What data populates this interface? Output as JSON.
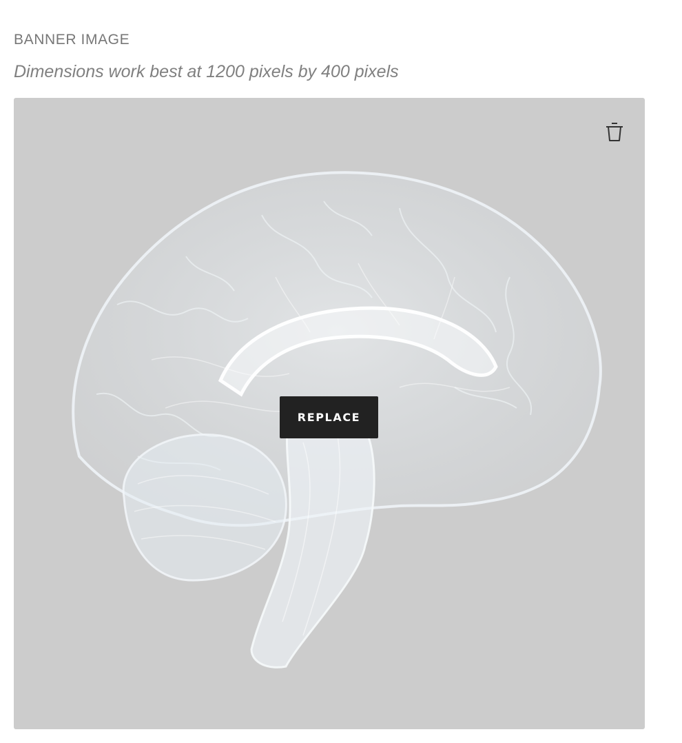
{
  "field": {
    "label": "BANNER IMAGE",
    "hint": "Dimensions work best at 1200 pixels by 400 pixels"
  },
  "image": {
    "subject": "translucent-brain-illustration",
    "background_color": "#cccccc"
  },
  "actions": {
    "replace_label": "REPLACE",
    "delete_icon": "trash-icon"
  },
  "colors": {
    "label_text": "#777777",
    "hint_text": "#808080",
    "button_bg": "#222222",
    "button_text": "#ffffff",
    "icon": "#333333"
  }
}
